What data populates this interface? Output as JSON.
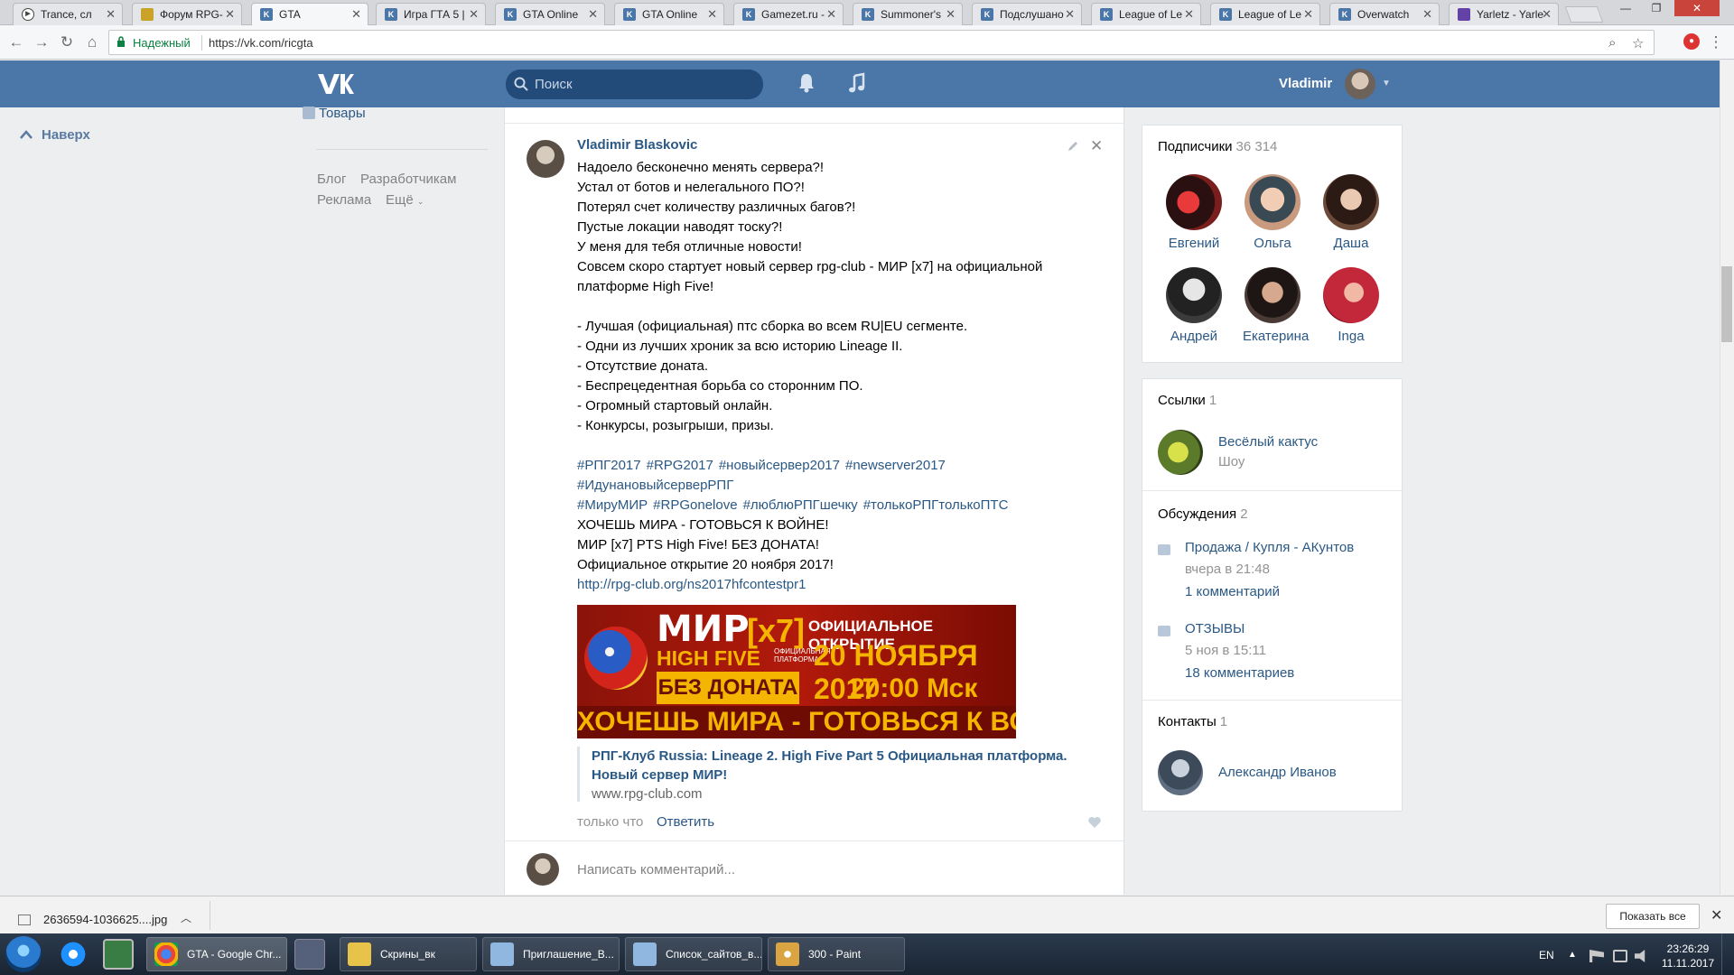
{
  "browser": {
    "tabs": [
      {
        "label": "Trance, сл",
        "icon": "play-icon"
      },
      {
        "label": "Форум RPG-",
        "icon": "forum-icon"
      },
      {
        "label": "GTA",
        "icon": "vk-icon",
        "active": true
      },
      {
        "label": "Игра ГТА 5 |",
        "icon": "vk-icon"
      },
      {
        "label": "GTA Online",
        "icon": "vk-icon"
      },
      {
        "label": "GTA Online",
        "icon": "vk-icon"
      },
      {
        "label": "Gamezet.ru -",
        "icon": "vk-icon"
      },
      {
        "label": "Summoner's",
        "icon": "vk-icon"
      },
      {
        "label": "Подслушано",
        "icon": "vk-icon"
      },
      {
        "label": "League of Le",
        "icon": "vk-icon"
      },
      {
        "label": "League of Le",
        "icon": "vk-icon"
      },
      {
        "label": "Overwatch",
        "icon": "vk-icon"
      },
      {
        "label": "Yarletz - Yarle",
        "icon": "twitch-icon"
      }
    ],
    "secure_label": "Надежный",
    "url": "https://vk.com/ricgta"
  },
  "vk": {
    "search_placeholder": "Поиск",
    "username": "Vladimir",
    "to_top": "Наверх",
    "left_menu_item": "Товары",
    "footer": {
      "blog": "Блог",
      "developers": "Разработчикам",
      "ads": "Реклама",
      "more": "Ещё"
    }
  },
  "post": {
    "author": "Vladimir Blaskovic",
    "lines": [
      "Надоело бесконечно менять сервера?!",
      "Устал от ботов и нелегального ПО?!",
      "Потерял счет количеству различных багов?!",
      "Пустые локации наводят тоску?!",
      "У меня для тебя отличные новости!",
      "Совсем скоро стартует новый сервер rpg-club - МИР [x7] на официальной",
      "платформе High Five!"
    ],
    "bullets": [
      "- Лучшая (официальная) птс сборка во всем RU|EU сегменте.",
      "- Одни из лучших хроник за всю историю Lineage II.",
      "- Отсутствие доната.",
      "- Беспрецедентная борьба со сторонним ПО.",
      "- Огромный стартовый онлайн.",
      "- Конкурсы, розыгрыши, призы."
    ],
    "tags_line1": [
      "#РПГ2017",
      "#RPG2017",
      "#новыйсервер2017",
      "#newserver2017"
    ],
    "tags_line2": [
      "#ИдунановыйсерверРПГ"
    ],
    "tags_line3": [
      "#МируМИР",
      "#RPGonelove",
      "#люблюРПГшечку",
      "#толькоРПГтолькоПТС"
    ],
    "outro": [
      "ХОЧЕШЬ МИРА - ГОТОВЬСЯ К ВОЙНЕ!",
      "МИР [x7] PTS High Five! БЕЗ ДОНАТА!",
      "Официальное открытие 20 ноября 2017!"
    ],
    "link": "http://rpg-club.org/ns2017hfcontestpr1",
    "banner": {
      "mir": "МИР",
      "x7": "[x7]",
      "high_five": "HIGH FIVE",
      "platform": "ОФИЦИАЛЬНАЯ ПЛАТФОРМА",
      "no_donate": "БЕЗ ДОНАТА",
      "official_open": "ОФИЦИАЛЬНОЕ ОТКРЫТИЕ",
      "date": "20 НОЯБРЯ 2017",
      "time": "20:00 Мск",
      "slogan": "ХОЧЕШЬ МИРА - ГОТОВЬСЯ К ВОЙНЕ"
    },
    "snippet_title": "РПГ-Клуб Russia: Lineage 2. High Five Part 5 Официальная платформа. Новый сервер МИР!",
    "snippet_domain": "www.rpg-club.com",
    "time": "только что",
    "reply": "Ответить",
    "comment_placeholder": "Написать комментарий..."
  },
  "sidebar": {
    "subscribers": {
      "title": "Подписчики",
      "count": "36 314",
      "people": [
        {
          "name": "Евгений",
          "color": "#7a1d1d"
        },
        {
          "name": "Ольга",
          "color": "#c99a7e"
        },
        {
          "name": "Даша",
          "color": "#6b4a3a"
        },
        {
          "name": "Андрей",
          "color": "#3b3b3b"
        },
        {
          "name": "Екатерина",
          "color": "#4a3a35"
        },
        {
          "name": "Inga",
          "color": "#c2283a"
        }
      ]
    },
    "links": {
      "title": "Ссылки",
      "count": "1",
      "name": "Весёлый кактус",
      "desc": "Шоу"
    },
    "discussions": {
      "title": "Обсуждения",
      "count": "2",
      "items": [
        {
          "title": "Продажа / Купля - АКунтов",
          "time": "вчера в 21:48",
          "comments": "1 комментарий"
        },
        {
          "title": "ОТЗЫВЫ",
          "time": "5 ноя в 15:11",
          "comments": "18 комментариев"
        }
      ]
    },
    "contacts": {
      "title": "Контакты",
      "count": "1",
      "name": "Александр Иванов"
    }
  },
  "downloads": {
    "file": "2636594-1036625....jpg",
    "show_all": "Показать все"
  },
  "taskbar": {
    "tasks": [
      {
        "label": "GTA - Google Chr...",
        "color": "#e8453c",
        "active": true
      },
      {
        "label": "Скрины_вк",
        "color": "#e8c34a"
      },
      {
        "label": "Приглашение_В...",
        "color": "#8fb7e0"
      },
      {
        "label": "Список_сайтов_в...",
        "color": "#8fb7e0"
      },
      {
        "label": "300 - Paint",
        "color": "#d9a441"
      }
    ],
    "lang": "EN",
    "time": "23:26:29",
    "date": "11.11.2017"
  },
  "colors": {
    "vk_blue": "#4a76a8",
    "link_blue": "#2a5885",
    "page_bg": "#edeef0"
  }
}
